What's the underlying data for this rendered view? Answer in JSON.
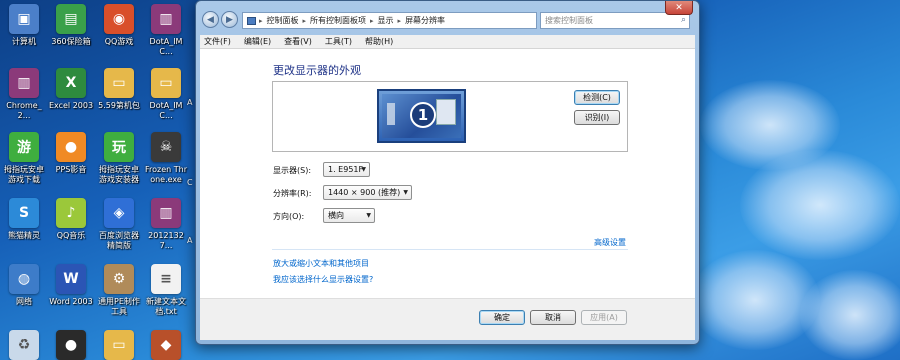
{
  "desktop": {
    "icons": [
      {
        "label": "计算机",
        "name": "computer-icon",
        "color": "#4b7fc9",
        "glyph": "▣"
      },
      {
        "label": "360保险箱",
        "name": "360-safe-box-icon",
        "color": "#3aa04a",
        "glyph": "▤"
      },
      {
        "label": "QQ游戏",
        "name": "qq-game-icon",
        "color": "#d94f2a",
        "glyph": "◉"
      },
      {
        "label": "DotA_IMC...",
        "name": "winrar-archive-icon",
        "color": "#8b3a7a",
        "glyph": "▥"
      },
      {
        "label": "Chrome_2...",
        "name": "winrar-archive-icon",
        "color": "#8b3a7a",
        "glyph": "▥"
      },
      {
        "label": "Excel 2003",
        "name": "excel-icon",
        "color": "#2e8b3e",
        "glyph": "X"
      },
      {
        "label": "5.59第机包",
        "name": "folder-icon",
        "color": "#e6b84a",
        "glyph": "▭"
      },
      {
        "label": "DotA_IMC...",
        "name": "folder-icon",
        "color": "#e6b84a",
        "glyph": "▭"
      },
      {
        "label": "拇指玩安卓游戏下载",
        "name": "muzhiwan-icon",
        "color": "#3fae3f",
        "glyph": "游"
      },
      {
        "label": "PPS影音",
        "name": "pps-player-icon",
        "color": "#f08a24",
        "glyph": "●"
      },
      {
        "label": "拇指玩安卓游戏安装器",
        "name": "muzhiwan-installer-icon",
        "color": "#3fae3f",
        "glyph": "玩"
      },
      {
        "label": "Frozen Throne.exe",
        "name": "frozen-throne-icon",
        "color": "#3a3a3a",
        "glyph": "☠"
      },
      {
        "label": "熊猫精灵",
        "name": "panda-icon",
        "color": "#2c8ad8",
        "glyph": "S"
      },
      {
        "label": "QQ音乐",
        "name": "qq-music-icon",
        "color": "#9bc83a",
        "glyph": "♪"
      },
      {
        "label": "百度浏览器精简版",
        "name": "baidu-browser-icon",
        "color": "#2f6fd6",
        "glyph": "◈"
      },
      {
        "label": "20121327...",
        "name": "winrar-archive-icon",
        "color": "#8b3a7a",
        "glyph": "▥"
      },
      {
        "label": "网络",
        "name": "network-icon",
        "color": "#3d7cc9",
        "glyph": "◍"
      },
      {
        "label": "Word 2003",
        "name": "word-icon",
        "color": "#2b55b5",
        "glyph": "W"
      },
      {
        "label": "通用PE制作工具",
        "name": "pe-tool-icon",
        "color": "#b08b5a",
        "glyph": "⚙"
      },
      {
        "label": "新建文本文档.txt",
        "name": "text-file-icon",
        "color": "#f2f2f2",
        "glyph": "≡"
      },
      {
        "label": "",
        "name": "recycle-bin-icon",
        "color": "#c9d9ea",
        "glyph": "♻"
      },
      {
        "label": "",
        "name": "qq-icon",
        "color": "#2a2a2a",
        "glyph": "●"
      },
      {
        "label": "",
        "name": "folder-icon",
        "color": "#e6b84a",
        "glyph": "▭"
      },
      {
        "label": "",
        "name": "game-icon",
        "color": "#b8502a",
        "glyph": "◆"
      }
    ],
    "right_edge_chars": [
      "A",
      "C",
      "A"
    ]
  },
  "window": {
    "address": {
      "segments": [
        "控制面板",
        "所有控制面板项",
        "显示",
        "屏幕分辨率"
      ],
      "separator": "▸"
    },
    "search_placeholder": "搜索控制面板",
    "close_glyph": "✕",
    "menu": [
      "文件(F)",
      "编辑(E)",
      "查看(V)",
      "工具(T)",
      "帮助(H)"
    ],
    "title": "更改显示器的外观",
    "monitor_number": "1",
    "detect_button": "检测(C)",
    "identify_button": "识别(I)",
    "fields": {
      "display_label": "显示器(S):",
      "display_value": "1. E951F",
      "resolution_label": "分辨率(R):",
      "resolution_value": "1440 × 900 (推荐)",
      "orientation_label": "方向(O):",
      "orientation_value": "横向"
    },
    "advanced_link": "高级设置",
    "links": [
      "放大或缩小文本和其他项目",
      "我应该选择什么显示器设置?"
    ],
    "footer": {
      "ok": "确定",
      "cancel": "取消",
      "apply": "应用(A)"
    }
  }
}
